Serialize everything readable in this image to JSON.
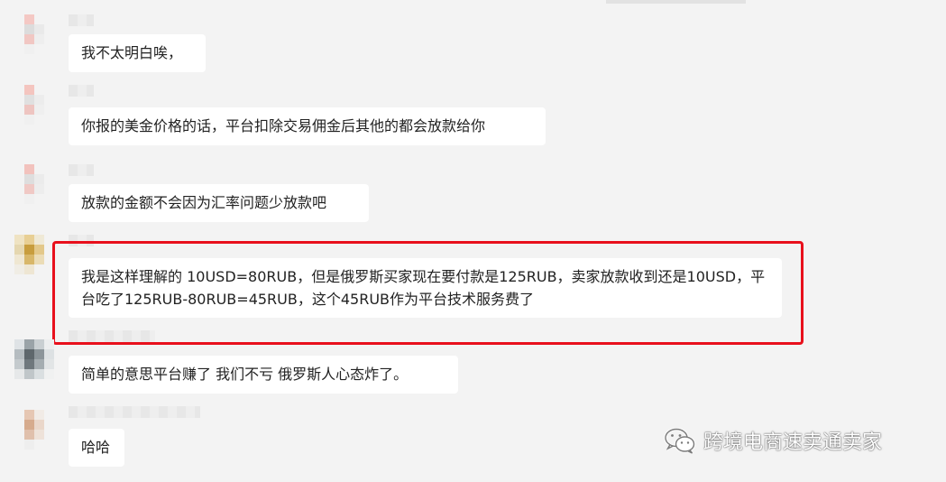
{
  "messages": [
    {
      "text": "我不太明白唉，"
    },
    {
      "text": "你报的美金价格的话，平台扣除交易佣金后其他的都会放款给你"
    },
    {
      "text": "放款的金额不会因为汇率问题少放款吧"
    },
    {
      "text": "我是这样理解的 10USD=80RUB，但是俄罗斯买家现在要付款是125RUB，卖家放款收到还是10USD，平台吃了125RUB-80RUB=45RUB，这个45RUB作为平台技术服务费了"
    },
    {
      "text": "简单的意思平台赚了 我们不亏 俄罗斯人心态炸了。"
    },
    {
      "text": "哈哈"
    }
  ],
  "watermark": {
    "icon": "wechat-icon",
    "text": "跨境电商速卖通卖家"
  },
  "colors": {
    "background": "#f3f3f3",
    "bubble": "#ffffff",
    "highlight": "#e8101c"
  }
}
